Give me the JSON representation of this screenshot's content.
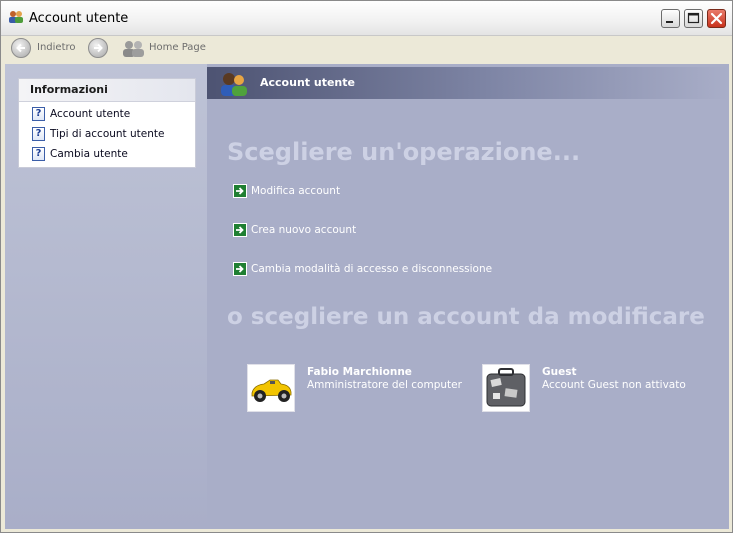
{
  "window": {
    "title": "Account utente"
  },
  "toolbar": {
    "back_label": "Indietro",
    "home_label": "Home Page"
  },
  "sidebar": {
    "panel_title": "Informazioni",
    "items": [
      {
        "label": "Account utente"
      },
      {
        "label": "Tipi di account utente"
      },
      {
        "label": "Cambia utente"
      }
    ]
  },
  "main": {
    "header_title": "Account utente",
    "pick_task": "Scegliere un'operazione...",
    "tasks": [
      {
        "label": "Modifica account"
      },
      {
        "label": "Crea nuovo account"
      },
      {
        "label": "Cambia modalità di accesso e disconnessione"
      }
    ],
    "pick_account": "o scegliere un account da modificare",
    "accounts": [
      {
        "name": "Fabio Marchionne",
        "description": "Amministratore del computer",
        "picture": "race-car-picture"
      },
      {
        "name": "Guest",
        "description": "Account Guest non attivato",
        "picture": "suitcase-picture"
      }
    ]
  },
  "colors": {
    "content_bg": "#a9aec8",
    "header_dark": "#4d5372",
    "heading_text": "#cdd1e4",
    "task_arrow": "#1f7f32"
  }
}
